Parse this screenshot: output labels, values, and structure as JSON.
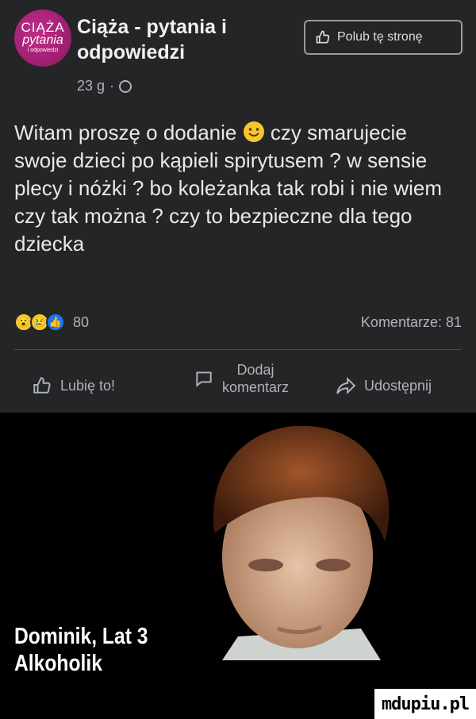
{
  "post": {
    "avatar": {
      "line1": "CIĄŻA",
      "line2": "pytania",
      "line3": "i odpowiedzi"
    },
    "page_name": "Ciąża - pytania i odpowiedzi",
    "time": "23 g",
    "visibility_icon": "globe-icon",
    "like_page_label": "Polub tę stronę",
    "text_before_emoji": "Witam proszę o dodanie",
    "emoji": "smile-emoji",
    "text_after_emoji": "czy smarujecie swoje dzieci po kąpieli spirytusem ?  w sensie plecy i nóżki ? bo koleżanka tak robi i nie wiem czy tak można ? czy to bezpieczne dla tego dziecka",
    "reaction_icons": [
      "wow-reaction",
      "sad-reaction",
      "like-reaction"
    ],
    "reaction_count": "80",
    "comment_count": "Komentarze: 81"
  },
  "actions": {
    "like_label": "Lubię to!",
    "comment_label_line1": "Dodaj",
    "comment_label_line2": "komentarz",
    "share_label": "Udostępnij"
  },
  "photo": {
    "caption_line1": "Dominik, Lat 3",
    "caption_line2": "Alkoholik",
    "watermark": "mdupiu.pl"
  },
  "colors": {
    "post_bg": "#242526",
    "accent_blue": "#1877f2",
    "avatar_pink": "#c22d8a"
  }
}
